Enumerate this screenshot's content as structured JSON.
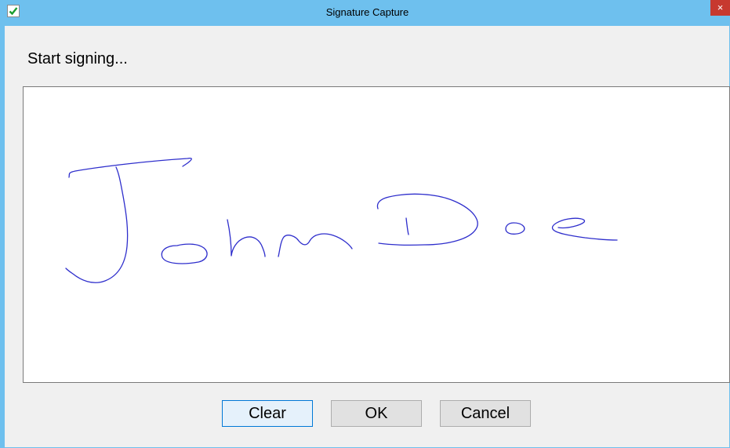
{
  "window": {
    "title": "Signature Capture",
    "icon": "checkmark-icon",
    "close_label": "×"
  },
  "prompt": "Start signing...",
  "signature": {
    "ink_color": "#2e2ecc",
    "content": "John Doe"
  },
  "buttons": {
    "clear_label": "Clear",
    "ok_label": "OK",
    "cancel_label": "Cancel"
  },
  "colors": {
    "titlebar": "#6ec0ee",
    "close": "#c7392f",
    "default_button_border": "#0078d7"
  }
}
